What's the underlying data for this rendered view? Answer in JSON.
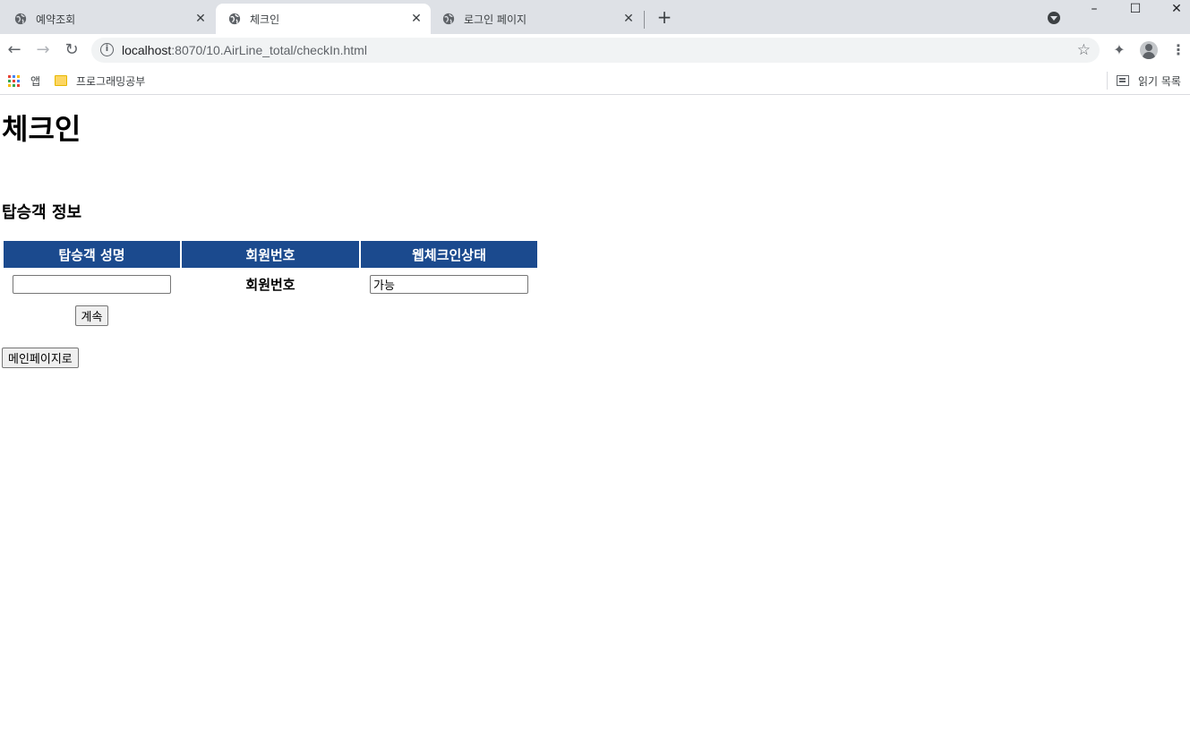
{
  "browser": {
    "tabs": [
      {
        "title": "예약조회",
        "active": false
      },
      {
        "title": "체크인",
        "active": true
      },
      {
        "title": "로그인 페이지",
        "active": false
      }
    ],
    "new_tab_label": "+",
    "window_controls": {
      "minimize": "–",
      "maximize": "☐",
      "close": "✕"
    },
    "url_host": "localhost",
    "url_path": ":8070/10.AirLine_total/checkIn.html",
    "bookmarks": [
      {
        "label": "앱",
        "icon": "apps-icon"
      },
      {
        "label": "프로그래밍공부",
        "icon": "folder-icon"
      }
    ],
    "reading_list_label": "읽기 목록"
  },
  "page": {
    "title": "체크인",
    "section_heading": "탑승객 정보",
    "table": {
      "headers": [
        "탑승객 성명",
        "회원번호",
        "웹체크인상태"
      ],
      "name_input_value": "",
      "member_number_text": "회원번호",
      "status_input_value": "가능"
    },
    "continue_button": "계속",
    "main_page_button": "메인페이지로"
  }
}
